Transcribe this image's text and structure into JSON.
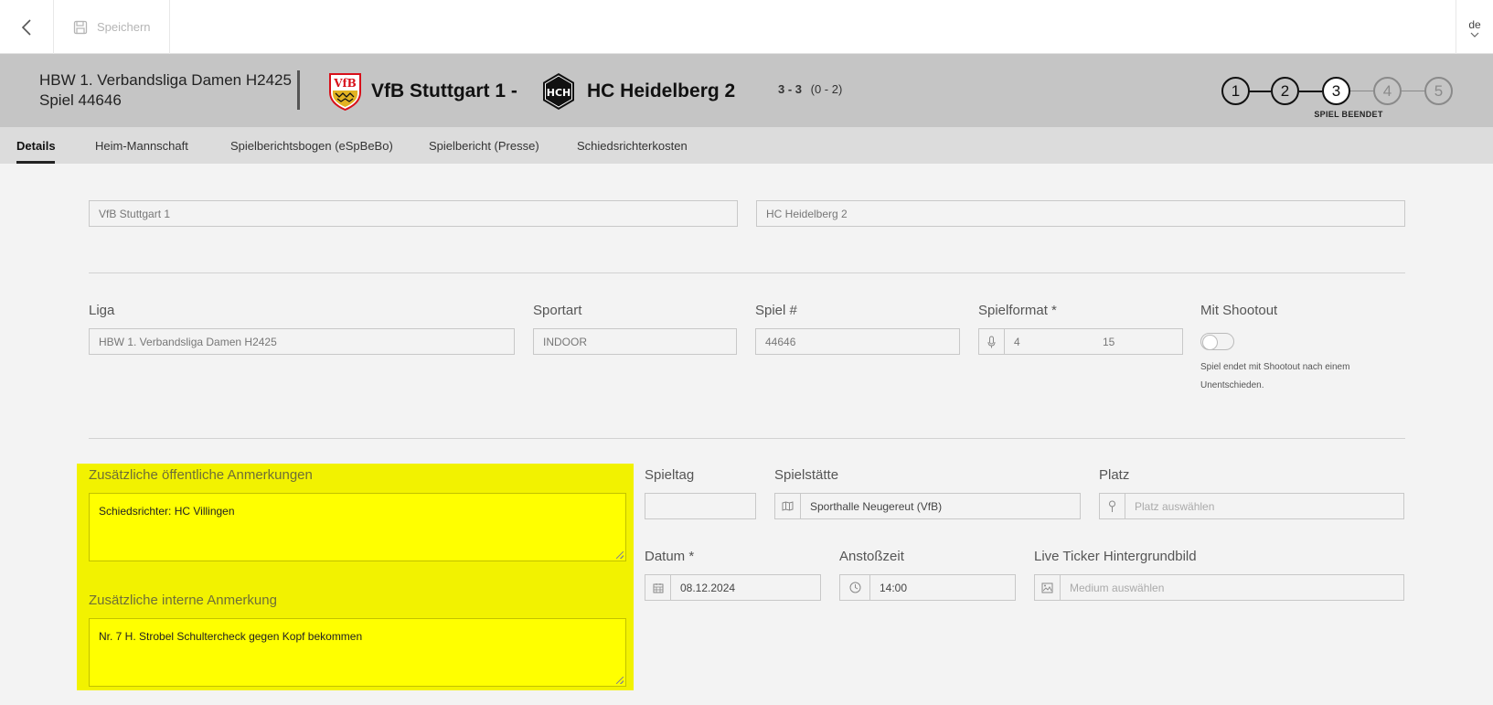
{
  "topbar": {
    "save_label": "Speichern",
    "language": "de"
  },
  "match": {
    "league_title": "HBW 1. Verbandsliga Damen H2425",
    "game_title": "Spiel 44646",
    "home_team": "VfB Stuttgart 1 -",
    "away_team": "HC Heidelberg 2",
    "score": "3 - 3",
    "halftime": "(0 - 2)",
    "away_logo_text": "HCH"
  },
  "steps": {
    "items": [
      "1",
      "2",
      "3",
      "4",
      "5"
    ],
    "current": 3,
    "current_label": "SPIEL BEENDET"
  },
  "tabs": [
    "Details",
    "Heim-Mannschaft",
    "Spielberichtsbogen (eSpBeBo)",
    "Spielbericht (Presse)",
    "Schiedsrichterkosten"
  ],
  "teams_fields": {
    "home": "VfB Stuttgart 1",
    "away": "HC Heidelberg 2"
  },
  "form": {
    "liga_label": "Liga",
    "liga_value": "HBW 1. Verbandsliga Damen H2425",
    "sportart_label": "Sportart",
    "sportart_value": "INDOOR",
    "spiel_label": "Spiel #",
    "spiel_value": "44646",
    "spielformat_label": "Spielformat *",
    "spielformat_value1": "4",
    "spielformat_value2": "15",
    "shootout_label": "Mit Shootout",
    "shootout_hint": "Spiel endet mit Shootout nach einem Unentschieden.",
    "public_notes_label": "Zusätzliche öffentliche Anmerkungen",
    "public_notes_value": "Schiedsrichter: HC Villingen",
    "internal_notes_label": "Zusätzliche interne Anmerkung",
    "internal_notes_value": "Nr. 7 H. Strobel Schultercheck gegen Kopf bekommen",
    "spieltag_label": "Spieltag",
    "spieltag_value": "",
    "spielstaette_label": "Spielstätte",
    "spielstaette_value": "Sporthalle Neugereut (VfB)",
    "platz_label": "Platz",
    "platz_placeholder": "Platz auswählen",
    "datum_label": "Datum *",
    "datum_value": "08.12.2024",
    "anstoss_label": "Anstoßzeit",
    "anstoss_value": "14:00",
    "ticker_label": "Live Ticker Hintergrundbild",
    "ticker_placeholder": "Medium auswählen"
  },
  "colors": {
    "highlight": "#f2f200",
    "header_bg": "#c5c5c5",
    "vfb_red": "#d8101a",
    "vfb_gold": "#e2b323"
  }
}
